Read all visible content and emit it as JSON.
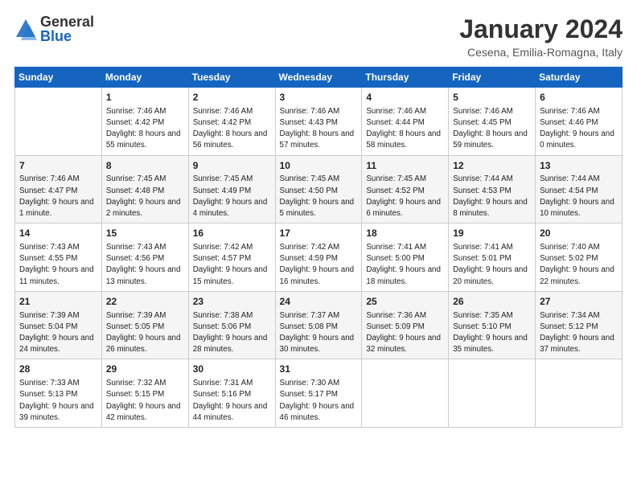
{
  "logo": {
    "general": "General",
    "blue": "Blue"
  },
  "title": "January 2024",
  "location": "Cesena, Emilia-Romagna, Italy",
  "days": [
    "Sunday",
    "Monday",
    "Tuesday",
    "Wednesday",
    "Thursday",
    "Friday",
    "Saturday"
  ],
  "weeks": [
    [
      {
        "day": "",
        "sunrise": "",
        "sunset": "",
        "daylight": ""
      },
      {
        "day": "1",
        "sunrise": "Sunrise: 7:46 AM",
        "sunset": "Sunset: 4:42 PM",
        "daylight": "Daylight: 8 hours and 55 minutes."
      },
      {
        "day": "2",
        "sunrise": "Sunrise: 7:46 AM",
        "sunset": "Sunset: 4:42 PM",
        "daylight": "Daylight: 8 hours and 56 minutes."
      },
      {
        "day": "3",
        "sunrise": "Sunrise: 7:46 AM",
        "sunset": "Sunset: 4:43 PM",
        "daylight": "Daylight: 8 hours and 57 minutes."
      },
      {
        "day": "4",
        "sunrise": "Sunrise: 7:46 AM",
        "sunset": "Sunset: 4:44 PM",
        "daylight": "Daylight: 8 hours and 58 minutes."
      },
      {
        "day": "5",
        "sunrise": "Sunrise: 7:46 AM",
        "sunset": "Sunset: 4:45 PM",
        "daylight": "Daylight: 8 hours and 59 minutes."
      },
      {
        "day": "6",
        "sunrise": "Sunrise: 7:46 AM",
        "sunset": "Sunset: 4:46 PM",
        "daylight": "Daylight: 9 hours and 0 minutes."
      }
    ],
    [
      {
        "day": "7",
        "sunrise": "Sunrise: 7:46 AM",
        "sunset": "Sunset: 4:47 PM",
        "daylight": "Daylight: 9 hours and 1 minute."
      },
      {
        "day": "8",
        "sunrise": "Sunrise: 7:45 AM",
        "sunset": "Sunset: 4:48 PM",
        "daylight": "Daylight: 9 hours and 2 minutes."
      },
      {
        "day": "9",
        "sunrise": "Sunrise: 7:45 AM",
        "sunset": "Sunset: 4:49 PM",
        "daylight": "Daylight: 9 hours and 4 minutes."
      },
      {
        "day": "10",
        "sunrise": "Sunrise: 7:45 AM",
        "sunset": "Sunset: 4:50 PM",
        "daylight": "Daylight: 9 hours and 5 minutes."
      },
      {
        "day": "11",
        "sunrise": "Sunrise: 7:45 AM",
        "sunset": "Sunset: 4:52 PM",
        "daylight": "Daylight: 9 hours and 6 minutes."
      },
      {
        "day": "12",
        "sunrise": "Sunrise: 7:44 AM",
        "sunset": "Sunset: 4:53 PM",
        "daylight": "Daylight: 9 hours and 8 minutes."
      },
      {
        "day": "13",
        "sunrise": "Sunrise: 7:44 AM",
        "sunset": "Sunset: 4:54 PM",
        "daylight": "Daylight: 9 hours and 10 minutes."
      }
    ],
    [
      {
        "day": "14",
        "sunrise": "Sunrise: 7:43 AM",
        "sunset": "Sunset: 4:55 PM",
        "daylight": "Daylight: 9 hours and 11 minutes."
      },
      {
        "day": "15",
        "sunrise": "Sunrise: 7:43 AM",
        "sunset": "Sunset: 4:56 PM",
        "daylight": "Daylight: 9 hours and 13 minutes."
      },
      {
        "day": "16",
        "sunrise": "Sunrise: 7:42 AM",
        "sunset": "Sunset: 4:57 PM",
        "daylight": "Daylight: 9 hours and 15 minutes."
      },
      {
        "day": "17",
        "sunrise": "Sunrise: 7:42 AM",
        "sunset": "Sunset: 4:59 PM",
        "daylight": "Daylight: 9 hours and 16 minutes."
      },
      {
        "day": "18",
        "sunrise": "Sunrise: 7:41 AM",
        "sunset": "Sunset: 5:00 PM",
        "daylight": "Daylight: 9 hours and 18 minutes."
      },
      {
        "day": "19",
        "sunrise": "Sunrise: 7:41 AM",
        "sunset": "Sunset: 5:01 PM",
        "daylight": "Daylight: 9 hours and 20 minutes."
      },
      {
        "day": "20",
        "sunrise": "Sunrise: 7:40 AM",
        "sunset": "Sunset: 5:02 PM",
        "daylight": "Daylight: 9 hours and 22 minutes."
      }
    ],
    [
      {
        "day": "21",
        "sunrise": "Sunrise: 7:39 AM",
        "sunset": "Sunset: 5:04 PM",
        "daylight": "Daylight: 9 hours and 24 minutes."
      },
      {
        "day": "22",
        "sunrise": "Sunrise: 7:39 AM",
        "sunset": "Sunset: 5:05 PM",
        "daylight": "Daylight: 9 hours and 26 minutes."
      },
      {
        "day": "23",
        "sunrise": "Sunrise: 7:38 AM",
        "sunset": "Sunset: 5:06 PM",
        "daylight": "Daylight: 9 hours and 28 minutes."
      },
      {
        "day": "24",
        "sunrise": "Sunrise: 7:37 AM",
        "sunset": "Sunset: 5:08 PM",
        "daylight": "Daylight: 9 hours and 30 minutes."
      },
      {
        "day": "25",
        "sunrise": "Sunrise: 7:36 AM",
        "sunset": "Sunset: 5:09 PM",
        "daylight": "Daylight: 9 hours and 32 minutes."
      },
      {
        "day": "26",
        "sunrise": "Sunrise: 7:35 AM",
        "sunset": "Sunset: 5:10 PM",
        "daylight": "Daylight: 9 hours and 35 minutes."
      },
      {
        "day": "27",
        "sunrise": "Sunrise: 7:34 AM",
        "sunset": "Sunset: 5:12 PM",
        "daylight": "Daylight: 9 hours and 37 minutes."
      }
    ],
    [
      {
        "day": "28",
        "sunrise": "Sunrise: 7:33 AM",
        "sunset": "Sunset: 5:13 PM",
        "daylight": "Daylight: 9 hours and 39 minutes."
      },
      {
        "day": "29",
        "sunrise": "Sunrise: 7:32 AM",
        "sunset": "Sunset: 5:15 PM",
        "daylight": "Daylight: 9 hours and 42 minutes."
      },
      {
        "day": "30",
        "sunrise": "Sunrise: 7:31 AM",
        "sunset": "Sunset: 5:16 PM",
        "daylight": "Daylight: 9 hours and 44 minutes."
      },
      {
        "day": "31",
        "sunrise": "Sunrise: 7:30 AM",
        "sunset": "Sunset: 5:17 PM",
        "daylight": "Daylight: 9 hours and 46 minutes."
      },
      {
        "day": "",
        "sunrise": "",
        "sunset": "",
        "daylight": ""
      },
      {
        "day": "",
        "sunrise": "",
        "sunset": "",
        "daylight": ""
      },
      {
        "day": "",
        "sunrise": "",
        "sunset": "",
        "daylight": ""
      }
    ]
  ]
}
